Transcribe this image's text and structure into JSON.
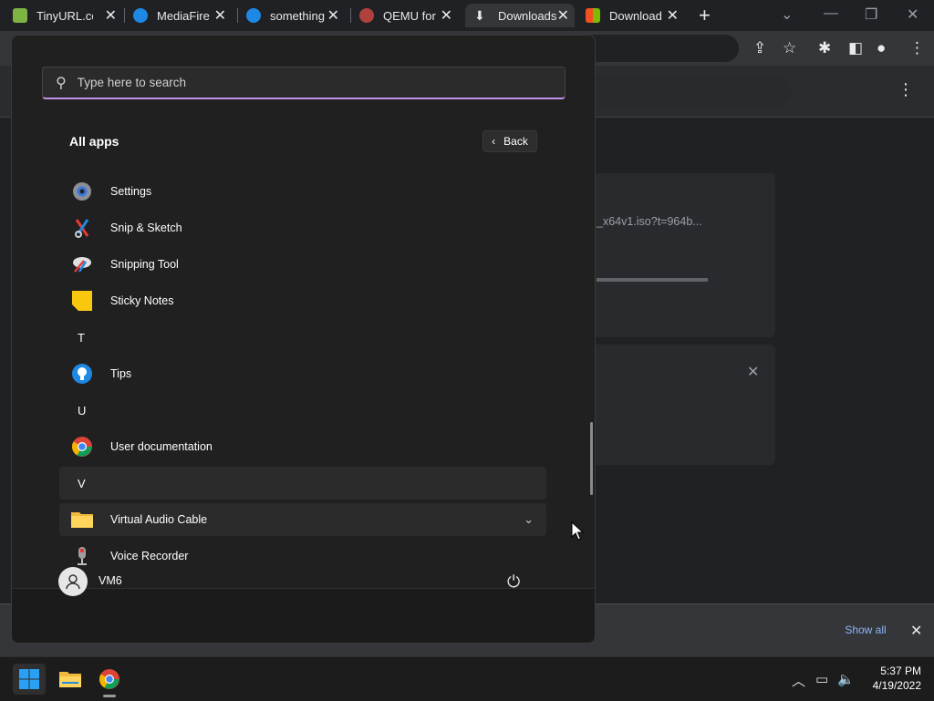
{
  "browser": {
    "tabs": [
      {
        "title": "TinyURL.com",
        "fav_color": "#7cb342"
      },
      {
        "title": "MediaFire -",
        "fav_color": "#1e88e5"
      },
      {
        "title": "something",
        "fav_color": "#1e88e5"
      },
      {
        "title": "QEMU for",
        "fav_color": "#b0413e"
      },
      {
        "title": "Downloads",
        "fav_color": "#e8eaed"
      },
      {
        "title": "Download",
        "fav_color": "#f25022"
      }
    ],
    "downloads": {
      "filename": "_x64v1.iso?t=964b..."
    },
    "shelf": {
      "show_all": "Show all"
    }
  },
  "start_menu": {
    "search_placeholder": "Type here to search",
    "heading": "All apps",
    "back_label": "Back",
    "entries": {
      "settings": "Settings",
      "snip_sketch": "Snip & Sketch",
      "snipping_tool": "Snipping Tool",
      "sticky_notes": "Sticky Notes",
      "letter_t": "T",
      "tips": "Tips",
      "letter_u": "U",
      "user_docs": "User documentation",
      "letter_v": "V",
      "virtual_audio": "Virtual Audio Cable",
      "voice_recorder": "Voice Recorder"
    },
    "user": "VM6"
  },
  "taskbar": {
    "time": "5:37 PM",
    "date": "4/19/2022"
  },
  "colors": {
    "accent": "#c293e8",
    "link": "#8ab4f8",
    "windows_blue": "#0a84ff"
  }
}
